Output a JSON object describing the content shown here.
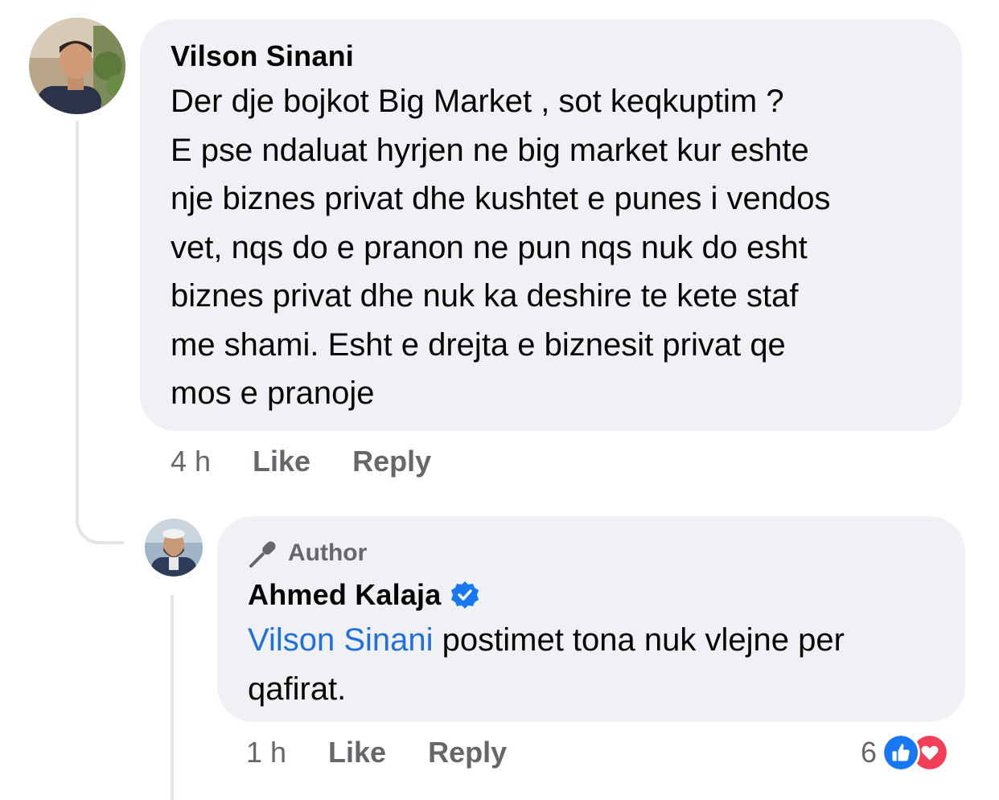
{
  "comment": {
    "author": "Vilson Sinani",
    "text": "Der dje bojkot Big Market , sot keqkuptim ?\nE pse ndaluat hyrjen ne big market kur eshte\nnje biznes privat dhe kushtet e punes i vendos\nvet, nqs do e pranon ne pun nqs nuk do esht\nbiznes privat dhe nuk ka deshire te kete staf\nme shami. Esht e drejta e biznesit privat qe\nmos e pranoje",
    "time": "4 h",
    "like_label": "Like",
    "reply_label": "Reply"
  },
  "reply": {
    "badge": "Author",
    "author": "Ahmed Kalaja",
    "mention": "Vilson Sinani",
    "text": " postimet tona nuk vlejne per\nqafirat.",
    "time": "1 h",
    "like_label": "Like",
    "reply_label": "Reply",
    "reaction_count": "6",
    "reactions": [
      "like-icon",
      "love-icon"
    ]
  },
  "colors": {
    "bubble": "#eff1f4",
    "mention": "#216fdb",
    "muted": "#65676b",
    "like": "#1877f2",
    "love": "#f33e58"
  }
}
